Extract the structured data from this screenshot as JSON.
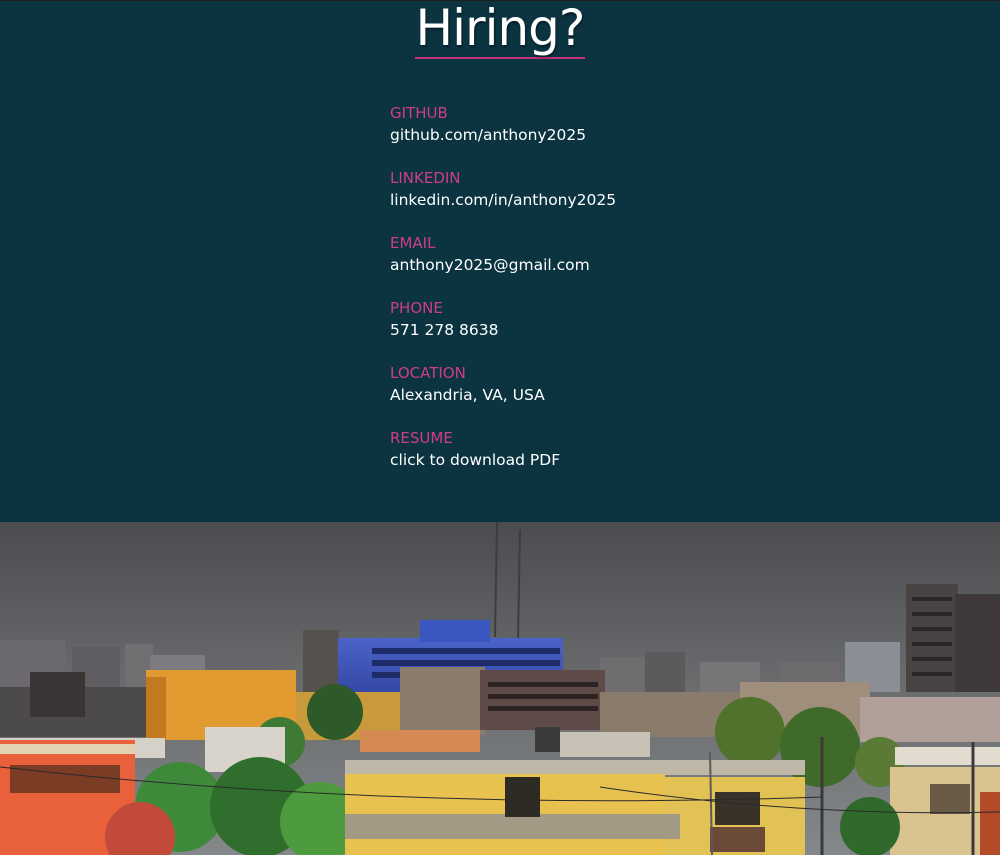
{
  "header": {
    "title": "Hiring?"
  },
  "contacts": [
    {
      "label": "GITHUB",
      "value": "github.com/anthony2025"
    },
    {
      "label": "LINKEDIN",
      "value": "linkedin.com/in/anthony2025"
    },
    {
      "label": "EMAIL",
      "value": "anthony2025@gmail.com"
    },
    {
      "label": "PHONE",
      "value": "571 278 8638"
    },
    {
      "label": "LOCATION",
      "value": "Alexandria, VA, USA"
    },
    {
      "label": "RESUME",
      "value": "click to download PDF"
    }
  ],
  "colors": {
    "background": "#0b3440",
    "label": "#cf3d8a",
    "underline": "#c2307f",
    "text": "#ffffff"
  }
}
